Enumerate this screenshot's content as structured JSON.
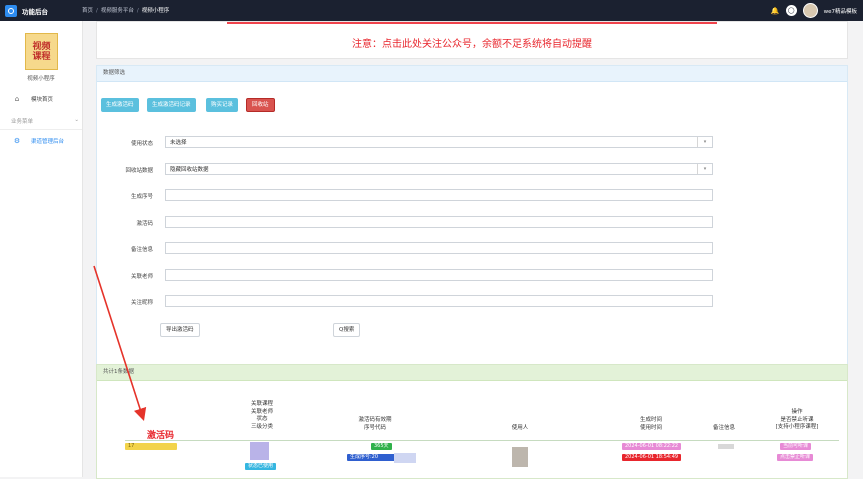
{
  "topbar": {
    "brand": "功能后台",
    "breadcrumbs": [
      "首页",
      "视频服务平台",
      "视频小程序"
    ],
    "username": "we7精品模板"
  },
  "sidebar": {
    "logo_lines": [
      "视频",
      "课程"
    ],
    "app_name": "视频小程序",
    "items": [
      {
        "label": "模块首页",
        "icon": "home-icon"
      },
      {
        "label": "业务菜单",
        "icon": "chevron-down-icon"
      },
      {
        "label": "渠道管理后台",
        "icon": "gear-icon"
      }
    ]
  },
  "notice": {
    "text": "注意：点击此处关注公众号，余额不足系统将自动提醒"
  },
  "filter": {
    "title": "数据筛选",
    "buttons": [
      "生成激活码",
      "生成激活码记录",
      "购买记录",
      "回收站"
    ],
    "fields": [
      {
        "label": "使用状态",
        "value": "未选择",
        "type": "select"
      },
      {
        "label": "回收站数据",
        "value": "隐藏回收站数据",
        "type": "select"
      },
      {
        "label": "生成序号",
        "value": "",
        "type": "text"
      },
      {
        "label": "激活码",
        "value": "",
        "type": "text"
      },
      {
        "label": "备注信息",
        "value": "",
        "type": "text"
      },
      {
        "label": "关联老师",
        "value": "",
        "type": "text"
      },
      {
        "label": "关注昵称",
        "value": "",
        "type": "text"
      }
    ],
    "export_label": "导出激活码",
    "search_label": "Q搜索"
  },
  "results": {
    "title": "共计1条数据",
    "highlight": "激活码",
    "columns": {
      "course": [
        "关联课程",
        "关联老师",
        "状态",
        "三级分类"
      ],
      "validity": [
        "激活码有效期",
        "序号代码"
      ],
      "user": [
        "使用人"
      ],
      "time": [
        "生成时间",
        "使用时间"
      ],
      "remark": [
        "备注信息"
      ],
      "ops": [
        "操作",
        "是否禁止听课",
        "[支持小程序课程]"
      ]
    },
    "row": {
      "code_prefix": "17",
      "status": "状态已使用",
      "days": "365天",
      "serial": "生成序号:20",
      "created": "2024-06-01 08:22:22",
      "used": "2024-06-01 18:54:49",
      "op_buttons": [
        "当前可听课",
        "点击禁止听课"
      ]
    }
  },
  "colors": {
    "topbar": "#1b2130",
    "notice": "#e8262d",
    "info_button": "#5bc0de",
    "danger_button": "#d9534f",
    "arrow": "#e5332a"
  }
}
